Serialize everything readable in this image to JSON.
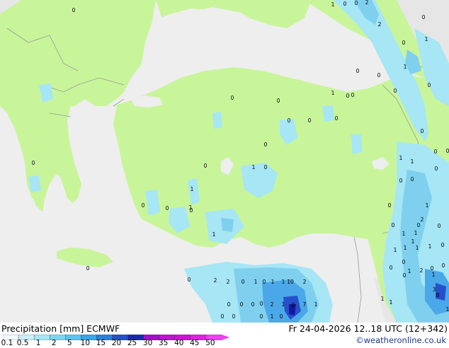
{
  "map": {
    "colors": {
      "sea": "#eeeeee",
      "land_model": "#c8f59a",
      "land_other": "#e6e6e6",
      "border": "#999999",
      "precip_light": "#a6e6f5",
      "precip_mid": "#7fd0ef",
      "precip_strong": "#4aa8e8",
      "precip_heavy": "#2650c8",
      "precip_extreme": "#1418a0"
    },
    "point_labels": [
      {
        "id": "p1",
        "text": "0"
      },
      {
        "id": "p2",
        "text": "1"
      },
      {
        "id": "p3",
        "text": "0"
      },
      {
        "id": "p4",
        "text": "0"
      },
      {
        "id": "p5",
        "text": "2"
      },
      {
        "id": "p6",
        "text": "0"
      },
      {
        "id": "p7",
        "text": "2"
      },
      {
        "id": "p8",
        "text": "0"
      },
      {
        "id": "p9",
        "text": "1"
      },
      {
        "id": "p10",
        "text": "0"
      },
      {
        "id": "p11",
        "text": "1"
      },
      {
        "id": "p12",
        "text": "0"
      },
      {
        "id": "p13",
        "text": "0"
      },
      {
        "id": "p14",
        "text": "1"
      },
      {
        "id": "p15",
        "text": "0"
      },
      {
        "id": "p16",
        "text": "0"
      },
      {
        "id": "p17",
        "text": "0"
      },
      {
        "id": "p18",
        "text": "0"
      },
      {
        "id": "p19",
        "text": "0"
      },
      {
        "id": "p20",
        "text": "0"
      },
      {
        "id": "p21",
        "text": "0"
      },
      {
        "id": "p22",
        "text": "0"
      },
      {
        "id": "p23",
        "text": "0"
      },
      {
        "id": "p24",
        "text": "0"
      },
      {
        "id": "p25",
        "text": "0"
      },
      {
        "id": "p26",
        "text": "0"
      },
      {
        "id": "p27",
        "text": "1"
      },
      {
        "id": "p28",
        "text": "0"
      },
      {
        "id": "p29",
        "text": "0"
      },
      {
        "id": "p30",
        "text": "0"
      },
      {
        "id": "p31",
        "text": "1"
      },
      {
        "id": "p32",
        "text": "0"
      },
      {
        "id": "p33",
        "text": "1"
      },
      {
        "id": "p34",
        "text": "0"
      },
      {
        "id": "p35",
        "text": "0"
      },
      {
        "id": "p36",
        "text": "1"
      },
      {
        "id": "p37",
        "text": "0"
      },
      {
        "id": "p38",
        "text": "0"
      },
      {
        "id": "p39",
        "text": "1"
      },
      {
        "id": "p40",
        "text": "1"
      },
      {
        "id": "p41",
        "text": "0"
      },
      {
        "id": "p42",
        "text": "0"
      },
      {
        "id": "p43",
        "text": "1"
      },
      {
        "id": "p44",
        "text": "0"
      },
      {
        "id": "p45",
        "text": "2"
      },
      {
        "id": "p46",
        "text": "1"
      },
      {
        "id": "p47",
        "text": "1"
      },
      {
        "id": "p48",
        "text": "0"
      },
      {
        "id": "p49",
        "text": "1"
      },
      {
        "id": "p50",
        "text": "0"
      },
      {
        "id": "p51",
        "text": "1"
      },
      {
        "id": "p52",
        "text": "1"
      },
      {
        "id": "p53",
        "text": "1"
      },
      {
        "id": "p54",
        "text": "1"
      },
      {
        "id": "p55",
        "text": "0"
      },
      {
        "id": "p56",
        "text": "0"
      },
      {
        "id": "p57",
        "text": "0"
      },
      {
        "id": "p58",
        "text": "0"
      },
      {
        "id": "p59",
        "text": "1"
      },
      {
        "id": "p60",
        "text": "2"
      },
      {
        "id": "p61",
        "text": "0"
      },
      {
        "id": "p62",
        "text": "0"
      },
      {
        "id": "p63",
        "text": "1"
      },
      {
        "id": "p64",
        "text": "1"
      },
      {
        "id": "p65",
        "text": "1"
      },
      {
        "id": "p66",
        "text": "3"
      },
      {
        "id": "p67",
        "text": "8"
      },
      {
        "id": "p68",
        "text": "1"
      },
      {
        "id": "p69",
        "text": "0"
      },
      {
        "id": "p70",
        "text": "0"
      },
      {
        "id": "p71",
        "text": "2"
      },
      {
        "id": "p72",
        "text": "2"
      },
      {
        "id": "p73",
        "text": "0"
      },
      {
        "id": "p74",
        "text": "1"
      },
      {
        "id": "p75",
        "text": "0"
      },
      {
        "id": "p76",
        "text": "1"
      },
      {
        "id": "p77",
        "text": "1"
      },
      {
        "id": "p78",
        "text": "10"
      },
      {
        "id": "p79",
        "text": "2"
      },
      {
        "id": "p80",
        "text": "0"
      },
      {
        "id": "p81",
        "text": "0"
      },
      {
        "id": "p82",
        "text": "0"
      },
      {
        "id": "p83",
        "text": "0"
      },
      {
        "id": "p84",
        "text": "2"
      },
      {
        "id": "p85",
        "text": "1"
      },
      {
        "id": "p86",
        "text": "0"
      },
      {
        "id": "p87",
        "text": "7"
      },
      {
        "id": "p88",
        "text": "1"
      },
      {
        "id": "p89",
        "text": "0"
      },
      {
        "id": "p90",
        "text": "0"
      },
      {
        "id": "p91",
        "text": "0"
      },
      {
        "id": "p92",
        "text": "1"
      },
      {
        "id": "p93",
        "text": "0"
      }
    ]
  },
  "footer": {
    "title": "Precipitation [mm]  ECMWF",
    "time_info": "Fr 24-04-2026 12..18 UTC (12+342)",
    "credit": "©weatheronline.co.uk",
    "colorbar": {
      "ticks": [
        "0.1",
        "0.5",
        "1",
        "2",
        "5",
        "10",
        "15",
        "20",
        "25",
        "30",
        "35",
        "40",
        "45",
        "50"
      ],
      "colors": [
        "#f2fbfd",
        "#c9f0f9",
        "#a6e6f5",
        "#7fd4f0",
        "#5ec4ec",
        "#3aa6e6",
        "#2e7fd8",
        "#2650c8",
        "#1a28b0",
        "#a010c8",
        "#c010d0",
        "#d010d8",
        "#e020e0",
        "#f040f0"
      ]
    }
  }
}
